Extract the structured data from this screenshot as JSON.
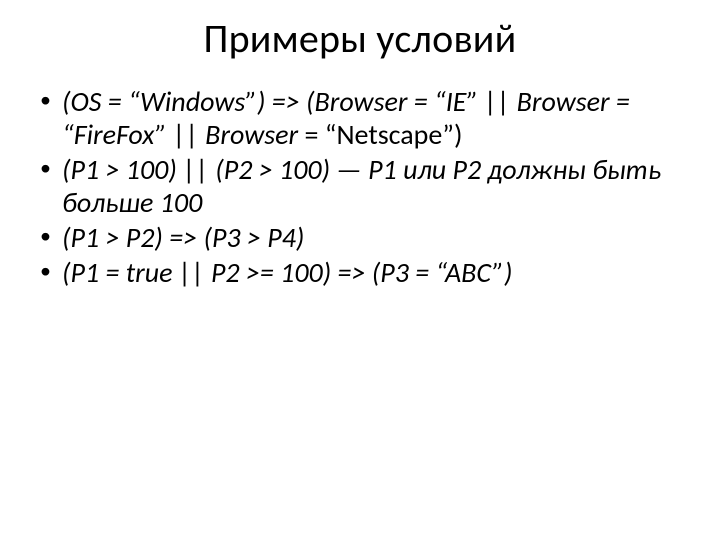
{
  "title": "Примеры условий",
  "bullets": {
    "b1_italic": "(OS = “Windows”) => (Browser = “IE” || Browser = “FireFox” || Browser",
    "b1_plain": " = “Netscape”)",
    "b2": "(P1 > 100) || (P2 > 100) — P1 или P2 должны быть больше 100",
    "b3": "(P1 > P2) => (P3 > P4)",
    "b4": "(P1 = true || P2 >= 100) => (P3 = “ABC”)"
  }
}
